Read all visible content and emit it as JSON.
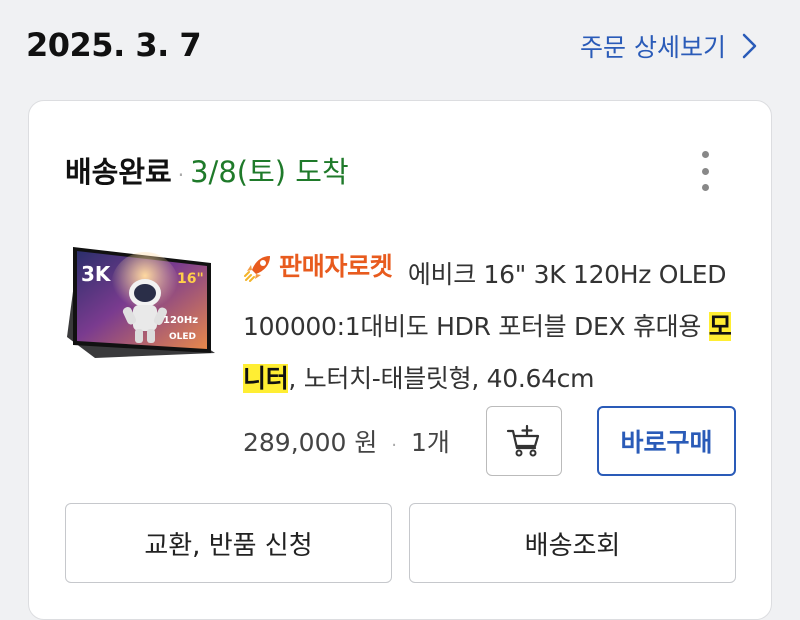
{
  "header": {
    "order_date": "2025. 3. 7",
    "order_detail_link": "주문 상세보기"
  },
  "shipment": {
    "status": "배송완료",
    "arrival": "3/8(토) 도착"
  },
  "product": {
    "badge": "판매자로켓",
    "title_part1": "에비크 16\" 3K 120Hz OLED 100000:1대비도 HDR 포터블 DEX 휴대용 ",
    "title_highlight": "모니터",
    "title_part2": ", 노터치-태블릿형, 40.64cm",
    "image_labels": {
      "resolution": "3K",
      "size": "16\"",
      "refresh": "120Hz",
      "panel": "OLED"
    },
    "price": "289,000 원",
    "quantity": "1개"
  },
  "buttons": {
    "buy_now": "바로구매",
    "exchange_return": "교환, 반품 신청",
    "track_delivery": "배송조회"
  },
  "colors": {
    "link_blue": "#2a5bb8",
    "arrival_green": "#1f7a2a",
    "rocket_orange": "#e85b1e",
    "highlight_yellow": "#ffee33"
  }
}
